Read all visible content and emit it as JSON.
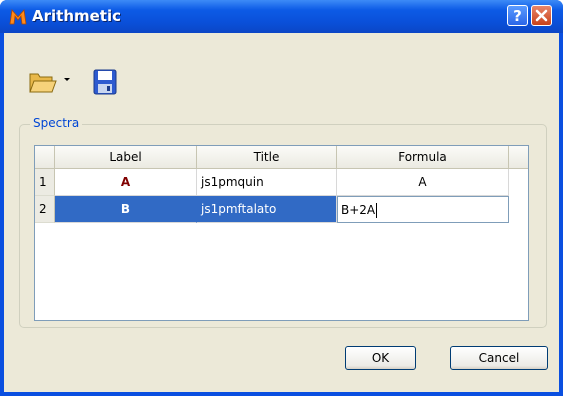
{
  "window": {
    "title": "Arithmetic"
  },
  "toolbar": {
    "open_icon": "folder-open-icon",
    "dropdown_icon": "dropdown-arrow-icon",
    "save_icon": "floppy-save-icon"
  },
  "group": {
    "label": "Spectra"
  },
  "table": {
    "headers": [
      "Label",
      "Title",
      "Formula"
    ],
    "rows": [
      {
        "num": "1",
        "label": "A",
        "title": "js1pmquin",
        "formula": "A"
      },
      {
        "num": "2",
        "label": "B",
        "title": "js1pmftalato",
        "formula": "B+2A"
      }
    ]
  },
  "buttons": {
    "ok": "OK",
    "cancel": "Cancel"
  },
  "colors": {
    "selection": "#316ac5",
    "label_text": "#800000",
    "titlebar": "#0a4fd8"
  }
}
